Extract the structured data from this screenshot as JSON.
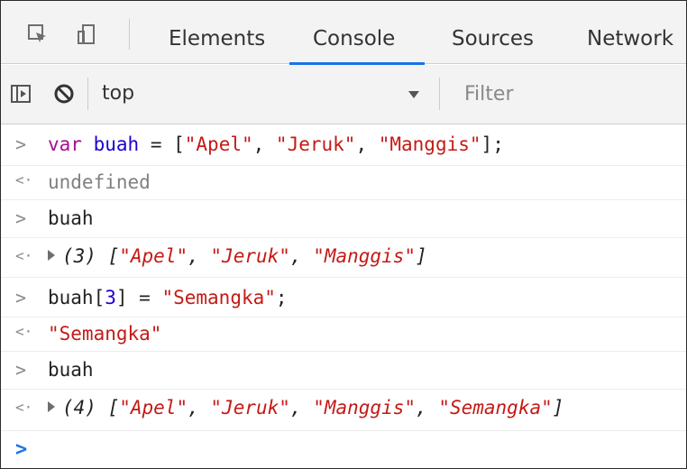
{
  "toolbar": {
    "inspect_icon": "inspect-element-icon",
    "device_icon": "device-toolbar-icon",
    "tabs": [
      {
        "label": "Elements"
      },
      {
        "label": "Console"
      },
      {
        "label": "Sources"
      },
      {
        "label": "Network"
      }
    ],
    "active_tab": "Console",
    "accent_color": "#1a73e8"
  },
  "filterbar": {
    "sidebar_icon": "console-sidebar-icon",
    "clear_icon": "clear-console-icon",
    "context": "top",
    "filter_placeholder": "Filter"
  },
  "console": {
    "prompt_in": ">",
    "prompt_out": "<·",
    "var_kw": "var",
    "var_name": "buah",
    "eq": " = ",
    "lb": "[",
    "rb": "]",
    "semi": ";",
    "comma": ", ",
    "s_apel": "\"Apel\"",
    "s_jeruk": "\"Jeruk\"",
    "s_manggis": "\"Manggis\"",
    "s_semangka": "\"Semangka\"",
    "undefined": "undefined",
    "cmd_buah": "buah",
    "count3": "(3)",
    "count4": "(4)",
    "idx_open": "buah[",
    "idx": "3",
    "idx_close": "]",
    "assign_eq": " = "
  }
}
